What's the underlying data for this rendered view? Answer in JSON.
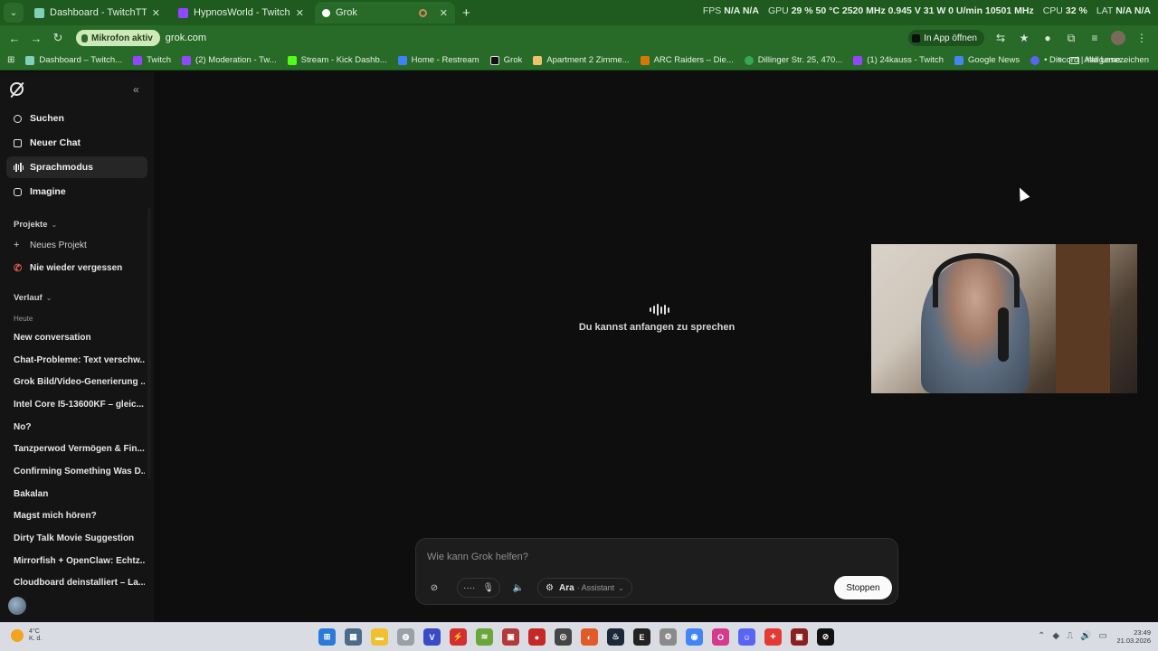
{
  "browser": {
    "tabs": [
      {
        "title": "Dashboard - TwitchTTS",
        "favicon_color": "#7fd1b9"
      },
      {
        "title": "HypnosWorld - Twitch",
        "favicon_color": "#9146ff"
      },
      {
        "title": "Grok",
        "favicon_color": "#ffffff",
        "active": true
      }
    ],
    "sys_stats": {
      "fps_label": "FPS",
      "fps_value": "N/A N/A",
      "gpu_label": "GPU",
      "gpu_value": "29 % 50 °C 2520 MHz 0.945 V 31 W 0 U/min 10501 MHz",
      "cpu_label": "CPU",
      "cpu_value": "32 %",
      "lat_label": "LAT",
      "lat_value": "N/A N/A"
    },
    "mic_badge": "Mikrofon aktiv",
    "url": "grok.com",
    "open_in_app": "In App öffnen",
    "bookmarks": [
      {
        "label": "Dashboard – Twitch...",
        "color": "#7fd1b9"
      },
      {
        "label": "Twitch",
        "color": "#9146ff"
      },
      {
        "label": "(2) Moderation - Tw...",
        "color": "#9146ff"
      },
      {
        "label": "Stream - Kick Dashb...",
        "color": "#53fc18"
      },
      {
        "label": "Home - Restream",
        "color": "#3b82f6"
      },
      {
        "label": "Grok",
        "color": "#111111"
      },
      {
        "label": "Apartment 2 Zimme...",
        "color": "#e9c46a"
      },
      {
        "label": "ARC Raiders – Die...",
        "color": "#d97706"
      },
      {
        "label": "Dillinger Str. 25, 470...",
        "color": "#34a853"
      },
      {
        "label": "(1) 24kauss - Twitch",
        "color": "#9146ff"
      },
      {
        "label": "Google News",
        "color": "#4285f4"
      },
      {
        "label": "• Discord | #allgeme...",
        "color": "#5865f2"
      }
    ],
    "all_bookmarks": "Alle Lesezeichen"
  },
  "sidebar": {
    "nav": [
      {
        "label": "Suchen",
        "icon": "search-icon"
      },
      {
        "label": "Neuer Chat",
        "icon": "edit-icon"
      },
      {
        "label": "Sprachmodus",
        "icon": "voice-icon",
        "active": true
      },
      {
        "label": "Imagine",
        "icon": "image-icon"
      }
    ],
    "projects_title": "Projekte",
    "new_project": "Neues Projekt",
    "never_forget": "Nie wieder vergessen",
    "history_title": "Verlauf",
    "today": "Heute",
    "history": [
      "New conversation",
      "Chat-Probleme: Text verschw...",
      "Grok Bild/Video-Generierung ...",
      "Intel Core I5-13600KF – gleic...",
      "No?",
      "Tanzperwod Vermögen & Fin...",
      "Confirming Something Was D...",
      "Bakalan",
      "Magst mich hören?",
      "Dirty Talk Movie Suggestion",
      "Mirrorfish + OpenClaw: Echtz...",
      "Cloudboard deinstalliert – La..."
    ]
  },
  "main": {
    "voice_prompt": "Du kannst anfangen zu sprechen",
    "composer": {
      "placeholder": "Wie kann Grok helfen?",
      "voice_name": "Ara",
      "voice_role": "· Assistant",
      "stop_label": "Stoppen"
    }
  },
  "taskbar": {
    "weather_temp": "4°C",
    "weather_text": "K. d.",
    "time": "23:49",
    "date": "21.03.2026"
  }
}
